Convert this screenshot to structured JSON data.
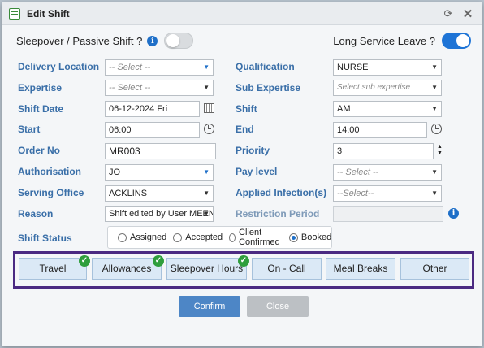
{
  "dialog": {
    "title": "Edit Shift"
  },
  "top": {
    "sleepover_label": "Sleepover / Passive Shift ?",
    "sleepover_on": false,
    "lsl_label": "Long Service Leave ?",
    "lsl_on": true
  },
  "fields": {
    "delivery_location": {
      "label": "Delivery Location",
      "value": "-- Select --"
    },
    "qualification": {
      "label": "Qualification",
      "value": "NURSE"
    },
    "expertise": {
      "label": "Expertise",
      "value": "-- Select --"
    },
    "sub_expertise": {
      "label": "Sub Expertise",
      "placeholder": "Select sub expertise"
    },
    "shift_date": {
      "label": "Shift Date",
      "value": "06-12-2024 Fri"
    },
    "shift": {
      "label": "Shift",
      "value": "AM"
    },
    "start": {
      "label": "Start",
      "value": "06:00"
    },
    "end": {
      "label": "End",
      "value": "14:00"
    },
    "order_no": {
      "label": "Order No",
      "value": "MR003"
    },
    "priority": {
      "label": "Priority",
      "value": "3"
    },
    "authorisation": {
      "label": "Authorisation",
      "value": "JO"
    },
    "pay_level": {
      "label": "Pay level",
      "value": "-- Select --"
    },
    "serving_office": {
      "label": "Serving Office",
      "value": "ACKLINS"
    },
    "applied_infections": {
      "label": "Applied Infection(s)",
      "value": "--Select--"
    },
    "reason": {
      "label": "Reason",
      "value": "Shift edited by User MEEN"
    },
    "restriction_period": {
      "label": "Restriction Period",
      "value": ""
    }
  },
  "shift_status": {
    "label": "Shift Status",
    "options": [
      "Assigned",
      "Accepted",
      "Client Confirmed",
      "Booked"
    ],
    "selected": "Booked"
  },
  "tabs": [
    {
      "label": "Travel",
      "checked": true
    },
    {
      "label": "Allowances",
      "checked": true
    },
    {
      "label": "Sleepover Hours",
      "checked": true
    },
    {
      "label": "On - Call",
      "checked": false
    },
    {
      "label": "Meal Breaks",
      "checked": false
    },
    {
      "label": "Other",
      "checked": false
    }
  ],
  "footer": {
    "confirm_label": "Confirm",
    "close_label": "Close"
  },
  "icons": {
    "app": "form-icon",
    "refresh": "refresh-icon",
    "close": "close-icon",
    "info": "info-icon",
    "calendar": "calendar-icon",
    "clock": "clock-icon",
    "check": "check-icon"
  }
}
